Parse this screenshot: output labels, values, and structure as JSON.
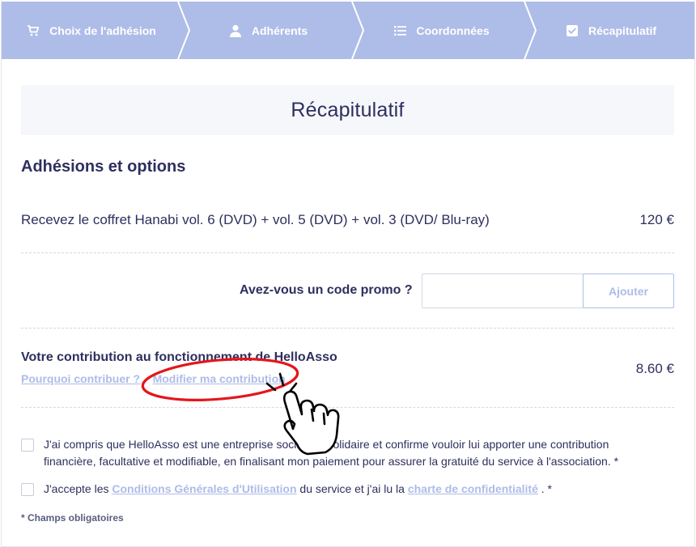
{
  "stepper": {
    "steps": [
      {
        "label": "Choix de l'adhésion",
        "icon": "cart-icon"
      },
      {
        "label": "Adhérents",
        "icon": "user-icon"
      },
      {
        "label": "Coordonnées",
        "icon": "list-icon"
      },
      {
        "label": "Récapitulatif",
        "icon": "checkbox-icon"
      }
    ],
    "color": "#aebce8"
  },
  "page": {
    "title": "Récapitulatif",
    "section_title": "Adhésions et options"
  },
  "item": {
    "label": "Recevez le coffret Hanabi vol. 6 (DVD) + vol. 5 (DVD) + vol. 3 (DVD/ Blu-ray)",
    "price": "120 €"
  },
  "promo": {
    "label": "Avez-vous un code promo ?",
    "value": "",
    "button_label": "Ajouter"
  },
  "contribution": {
    "title": "Votre contribution au fonctionnement de HelloAsso",
    "why_link": "Pourquoi contribuer ?",
    "modify_link": "Modifier ma contribution",
    "price": "8.60 €"
  },
  "consents": {
    "first": "J'ai compris que HelloAsso est une entreprise sociale et solidaire et confirme vouloir lui apporter une contribution financière, facultative et modifiable, en finalisant mon paiement pour assurer la gratuité du service à l'association. *",
    "second_before": "J'accepte les ",
    "cgu_link": "Conditions Générales d'Utilisation",
    "second_middle": " du service et j'ai lu la ",
    "privacy_link": "charte de confidentialité",
    "second_after": " . *"
  },
  "required_note": "* Champs obligatoires",
  "colors": {
    "accent": "#aebce8",
    "text": "#2e2f5e",
    "annotation": "#e3161c"
  }
}
